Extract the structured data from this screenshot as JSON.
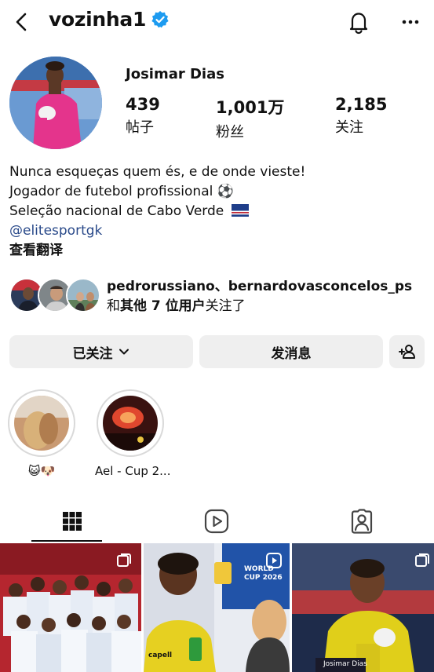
{
  "header": {
    "username": "vozinha1",
    "back_icon": "back-arrow-icon",
    "verified_icon": "verified-badge-icon",
    "bell_icon": "bell-icon",
    "more_icon": "more-dots-icon"
  },
  "profile": {
    "display_name": "Josimar Dias",
    "stats": [
      {
        "value": "439",
        "label": "帖子"
      },
      {
        "value": "1,001万",
        "label": "粉丝"
      },
      {
        "value": "2,185",
        "label": "关注"
      }
    ]
  },
  "bio": {
    "line1": "Nunca esqueças quem és, e de onde vieste!",
    "line2": "Jogador de futebol profissional ⚽",
    "line3": "Seleção nacional de Cabo Verde",
    "flag": "cape-verde-flag",
    "link": "@elitesportgk",
    "translate": "查看翻译"
  },
  "followed_by": {
    "names": "pedrorussiano、bernardovasconcelos_ps",
    "prefix": "和",
    "others": "其他 7 位用户",
    "suffix": "关注了"
  },
  "buttons": {
    "following": "已关注",
    "message": "发消息",
    "add_user_icon": "add-user-icon"
  },
  "highlights": [
    {
      "label": "😺🐶"
    },
    {
      "label": "Ael - Cup 2..."
    }
  ],
  "tabs": [
    {
      "icon": "grid-icon"
    },
    {
      "icon": "reels-icon"
    },
    {
      "icon": "tagged-icon"
    }
  ],
  "grid": {
    "post2_badge": "WORLD CUP 2026",
    "post2_brand": "capell",
    "post3_caption": "Josimar Dias"
  },
  "colors": {
    "accent_link": "#2a4a8a",
    "verified": "#1d9bf0",
    "button_bg": "#efefef"
  }
}
